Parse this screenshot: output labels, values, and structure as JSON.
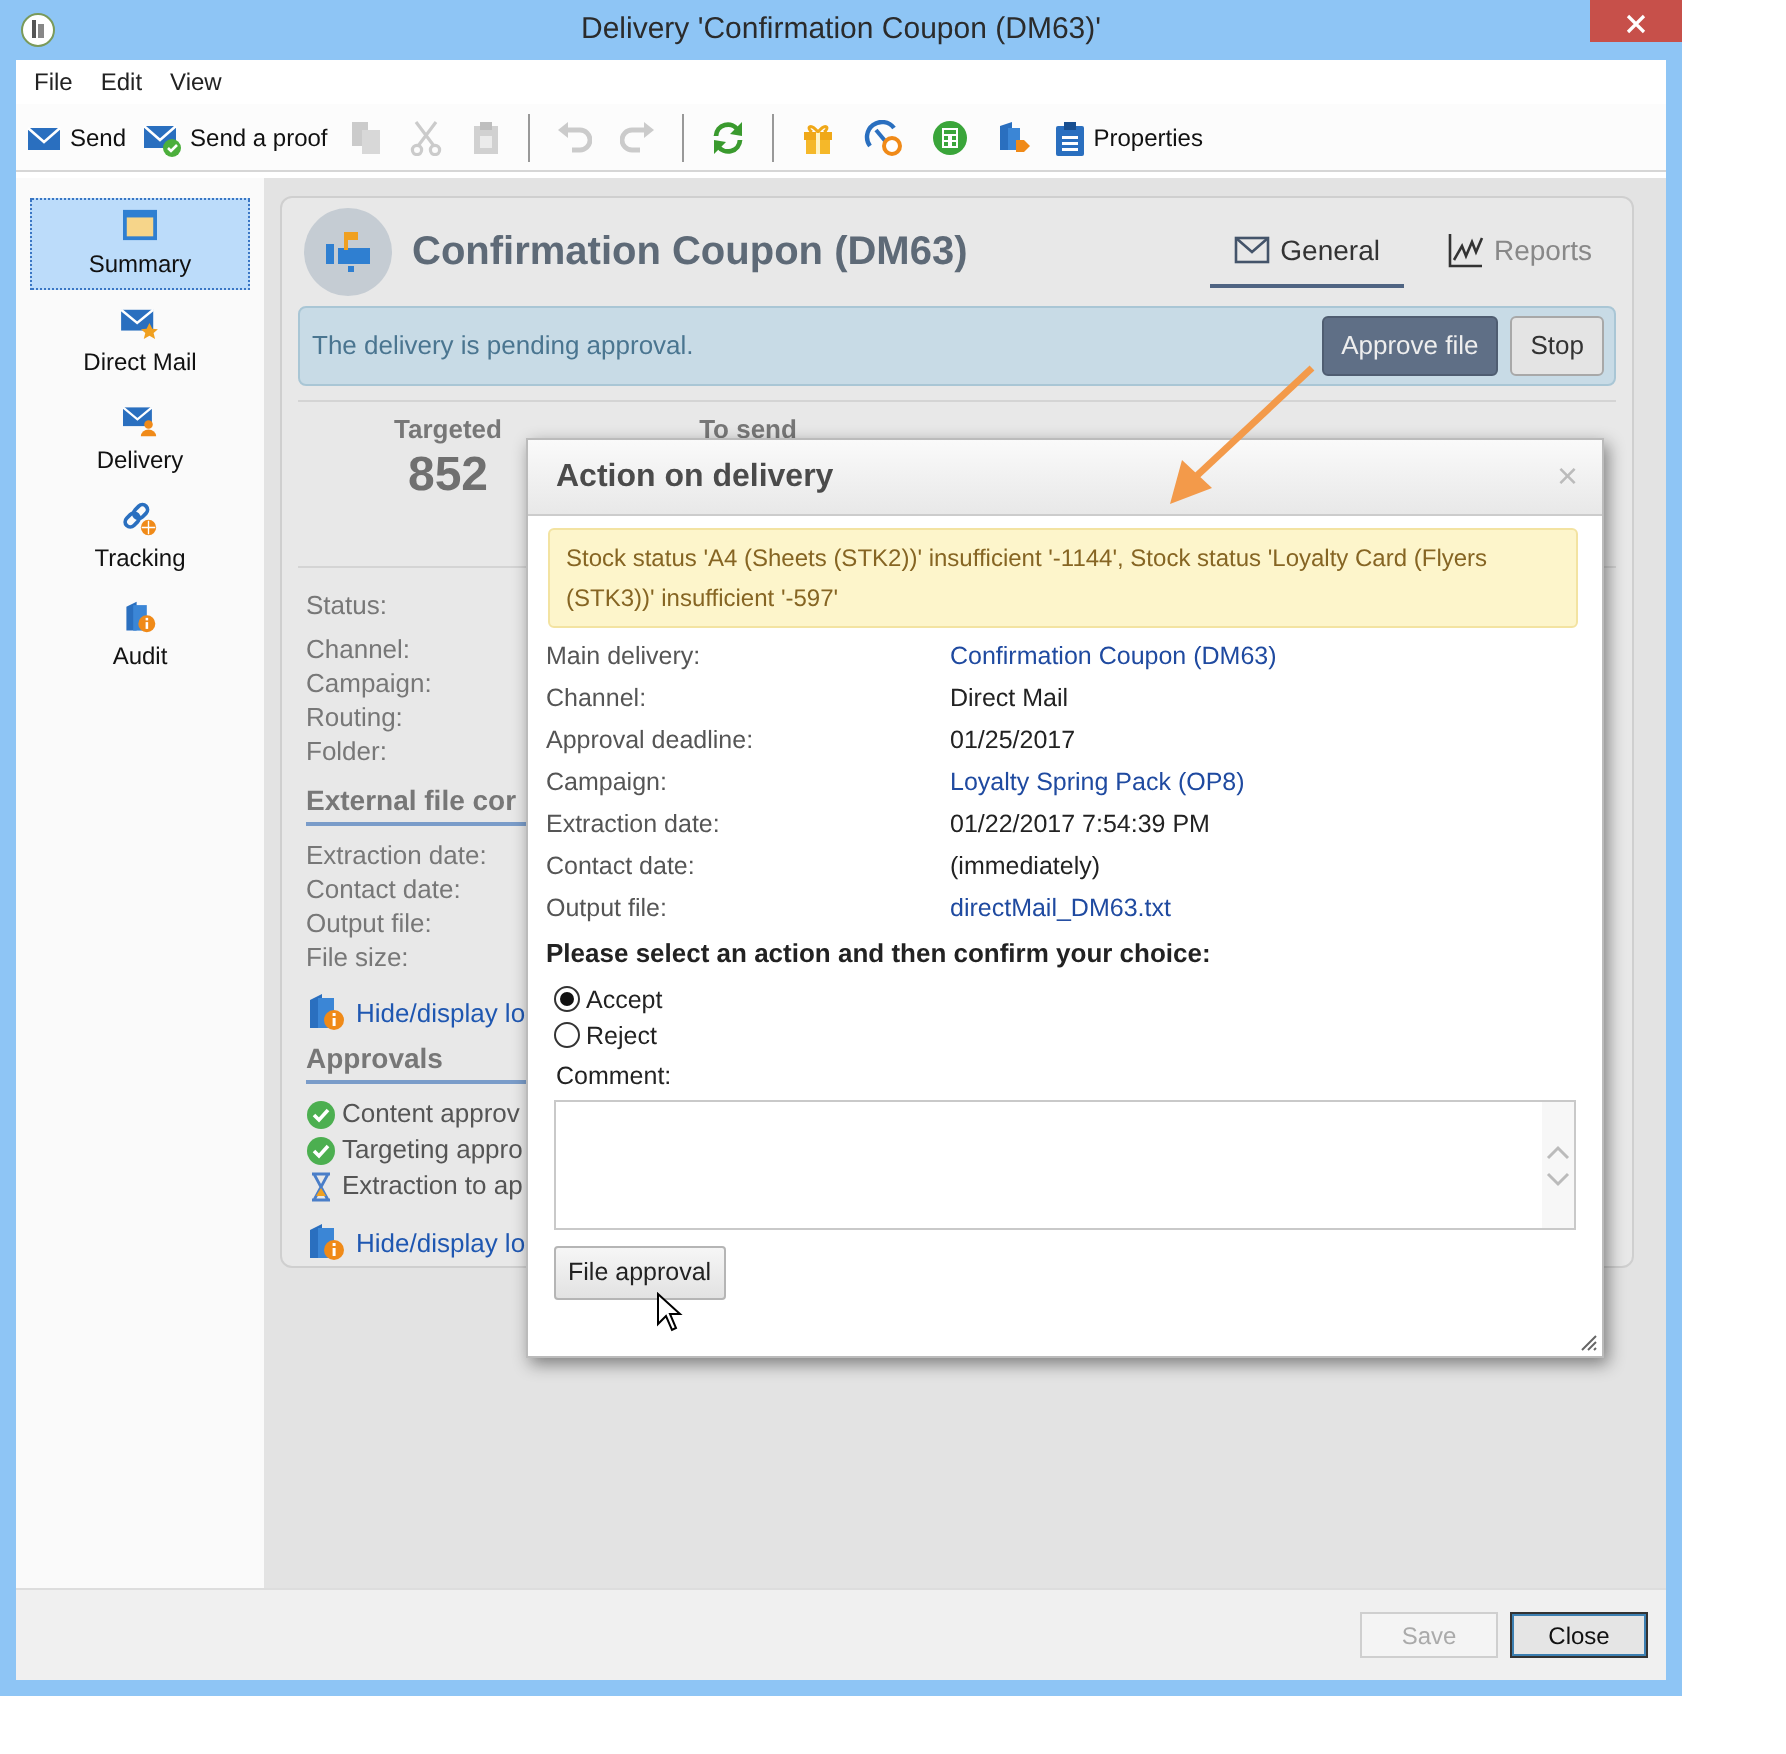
{
  "window": {
    "title": "Delivery 'Confirmation Coupon (DM63)'"
  },
  "menu": [
    "File",
    "Edit",
    "View"
  ],
  "toolbar": [
    {
      "kind": "send",
      "label": "Send",
      "disabled": false
    },
    {
      "kind": "proof",
      "label": "Send a proof",
      "disabled": false
    },
    {
      "kind": "copy",
      "disabled": true
    },
    {
      "kind": "cut",
      "disabled": true
    },
    {
      "kind": "paste",
      "disabled": true
    },
    {
      "kind": "separator"
    },
    {
      "kind": "undo",
      "disabled": true
    },
    {
      "kind": "redo",
      "disabled": true
    },
    {
      "kind": "separator"
    },
    {
      "kind": "refresh",
      "disabled": false
    },
    {
      "kind": "separator"
    },
    {
      "kind": "gift",
      "disabled": false
    },
    {
      "kind": "gauge",
      "disabled": false
    },
    {
      "kind": "calculator",
      "disabled": false
    },
    {
      "kind": "tag",
      "disabled": false
    },
    {
      "kind": "properties",
      "label": "Properties",
      "disabled": false
    }
  ],
  "sidebar": {
    "items": [
      {
        "kind": "summary",
        "label": "Summary",
        "selected": true
      },
      {
        "kind": "direct_mail",
        "label": "Direct Mail",
        "selected": false
      },
      {
        "kind": "delivery",
        "label": "Delivery",
        "selected": false
      },
      {
        "kind": "tracking",
        "label": "Tracking",
        "selected": false
      },
      {
        "kind": "audit",
        "label": "Audit",
        "selected": false
      }
    ]
  },
  "panel": {
    "title": "Confirmation Coupon (DM63)",
    "tabs": [
      {
        "kind": "general",
        "label": "General",
        "selected": true
      },
      {
        "kind": "reports",
        "label": "Reports",
        "selected": false
      }
    ],
    "alert": {
      "text": "The delivery is pending approval.",
      "buttons": [
        {
          "label": "Approve file",
          "primary": true
        },
        {
          "label": "Stop",
          "primary": false
        }
      ]
    },
    "stats": [
      {
        "label": "Targeted",
        "value": "852"
      },
      {
        "label": "To send"
      }
    ],
    "fields": [
      "Status:",
      "Channel:",
      "Campaign:",
      "Routing:",
      "Folder:"
    ],
    "sections": [
      {
        "title": "External file cor",
        "fields": [
          "Extraction date:",
          "Contact date:",
          "Output file:",
          "File size:"
        ],
        "link": "Hide/display lo"
      },
      {
        "title": "Approvals",
        "approvals": [
          {
            "label": "Content approv",
            "done": true
          },
          {
            "label": "Targeting appro",
            "done": true
          },
          {
            "label": "Extraction to ap",
            "done": false
          }
        ],
        "link": "Hide/display lo"
      }
    ]
  },
  "dialog": {
    "title": "Action on delivery",
    "close": "×",
    "warning": "Stock status 'A4 (Sheets (STK2))' insufficient '-1144', Stock status 'Loyalty Card (Flyers (STK3))' insufficient '-597'",
    "rows": [
      {
        "label": "Main delivery:",
        "value": "Confirmation Coupon (DM63)",
        "link": true
      },
      {
        "label": "Channel:",
        "value": "Direct Mail",
        "link": false
      },
      {
        "label": "Approval deadline:",
        "value": "01/25/2017",
        "link": false
      },
      {
        "label": "Campaign:",
        "value": "Loyalty Spring Pack (OP8)",
        "link": true
      },
      {
        "label": "Extraction date:",
        "value": "01/22/2017 7:54:39 PM",
        "link": false
      },
      {
        "label": "Contact date:",
        "value": "(immediately)",
        "link": false
      },
      {
        "label": "Output file:",
        "value": "directMail_DM63.txt",
        "link": true
      }
    ],
    "prompt": "Please select an action and then confirm your choice:",
    "options": [
      {
        "label": "Accept",
        "selected": true
      },
      {
        "label": "Reject",
        "selected": false
      }
    ],
    "comment_label": "Comment:",
    "submit": "File approval"
  },
  "footer": {
    "buttons": [
      {
        "label": "Save",
        "disabled": true
      },
      {
        "label": "Close",
        "disabled": false
      }
    ]
  }
}
